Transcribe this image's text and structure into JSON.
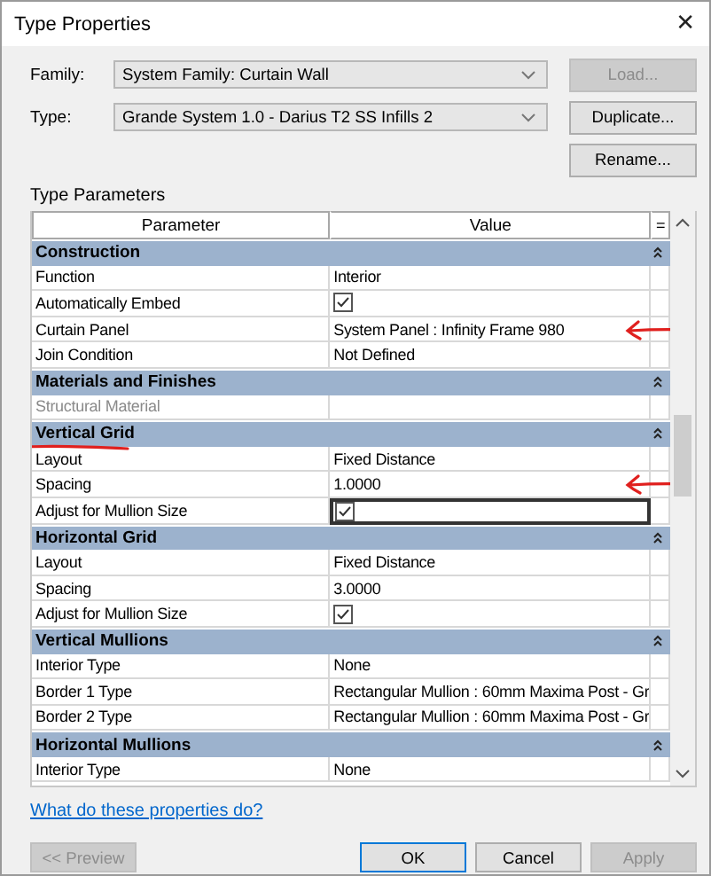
{
  "window": {
    "title": "Type Properties",
    "close": "✕"
  },
  "family": {
    "label": "Family:",
    "value": "System Family: Curtain Wall"
  },
  "type": {
    "label": "Type:",
    "value": "Grande System 1.0 - Darius T2 SS Infills 2"
  },
  "side_buttons": [
    {
      "label": "Load...",
      "disabled": true
    },
    {
      "label": "Duplicate...",
      "disabled": false
    },
    {
      "label": "Rename...",
      "disabled": false
    }
  ],
  "section_title": "Type Parameters",
  "table": {
    "columns": [
      "Parameter",
      "Value",
      "="
    ],
    "rows": [
      {
        "kind": "group",
        "name": "Construction"
      },
      {
        "kind": "text",
        "name": "Function",
        "value": "Interior",
        "disabled": false,
        "selected": false
      },
      {
        "kind": "check",
        "name": "Automatically Embed",
        "checked": true,
        "disabled": false,
        "selected": false
      },
      {
        "kind": "text",
        "name": "Curtain Panel",
        "value": "System Panel : Infinity Frame 980",
        "disabled": false,
        "selected": false,
        "arrow_mark": true
      },
      {
        "kind": "text",
        "name": "Join Condition",
        "value": "Not Defined",
        "disabled": false,
        "selected": false
      },
      {
        "kind": "group",
        "name": "Materials and Finishes"
      },
      {
        "kind": "text",
        "name": "Structural Material",
        "value": "",
        "disabled": true,
        "selected": false
      },
      {
        "kind": "group",
        "name": "Vertical Grid",
        "underline_mark": true
      },
      {
        "kind": "text",
        "name": "Layout",
        "value": "Fixed Distance",
        "disabled": false,
        "selected": false
      },
      {
        "kind": "text",
        "name": "Spacing",
        "value": "1.0000",
        "disabled": false,
        "selected": false,
        "arrow_mark": true
      },
      {
        "kind": "check",
        "name": "Adjust for Mullion Size",
        "checked": true,
        "disabled": false,
        "selected": true
      },
      {
        "kind": "group",
        "name": "Horizontal Grid"
      },
      {
        "kind": "text",
        "name": "Layout",
        "value": "Fixed Distance",
        "disabled": false,
        "selected": false
      },
      {
        "kind": "text",
        "name": "Spacing",
        "value": "3.0000",
        "disabled": false,
        "selected": false
      },
      {
        "kind": "check",
        "name": "Adjust for Mullion Size",
        "checked": true,
        "disabled": false,
        "selected": false
      },
      {
        "kind": "group",
        "name": "Vertical Mullions"
      },
      {
        "kind": "text",
        "name": "Interior Type",
        "value": "None",
        "disabled": false,
        "selected": false
      },
      {
        "kind": "text",
        "name": "Border 1 Type",
        "value": "Rectangular Mullion : 60mm Maxima Post - Gr",
        "disabled": false,
        "selected": false
      },
      {
        "kind": "text",
        "name": "Border 2 Type",
        "value": "Rectangular Mullion : 60mm Maxima Post - Gr",
        "disabled": false,
        "selected": false
      },
      {
        "kind": "group",
        "name": "Horizontal Mullions"
      },
      {
        "kind": "text",
        "name": "Interior Type",
        "value": "None",
        "disabled": false,
        "selected": false
      }
    ]
  },
  "help_link": "What do these properties do?",
  "buttons": [
    {
      "label": "<< Preview",
      "disabled": true,
      "default": false
    },
    {
      "label": "OK",
      "disabled": false,
      "default": true
    },
    {
      "label": "Cancel",
      "disabled": false,
      "default": false
    },
    {
      "label": "Apply",
      "disabled": true,
      "default": false
    }
  ]
}
